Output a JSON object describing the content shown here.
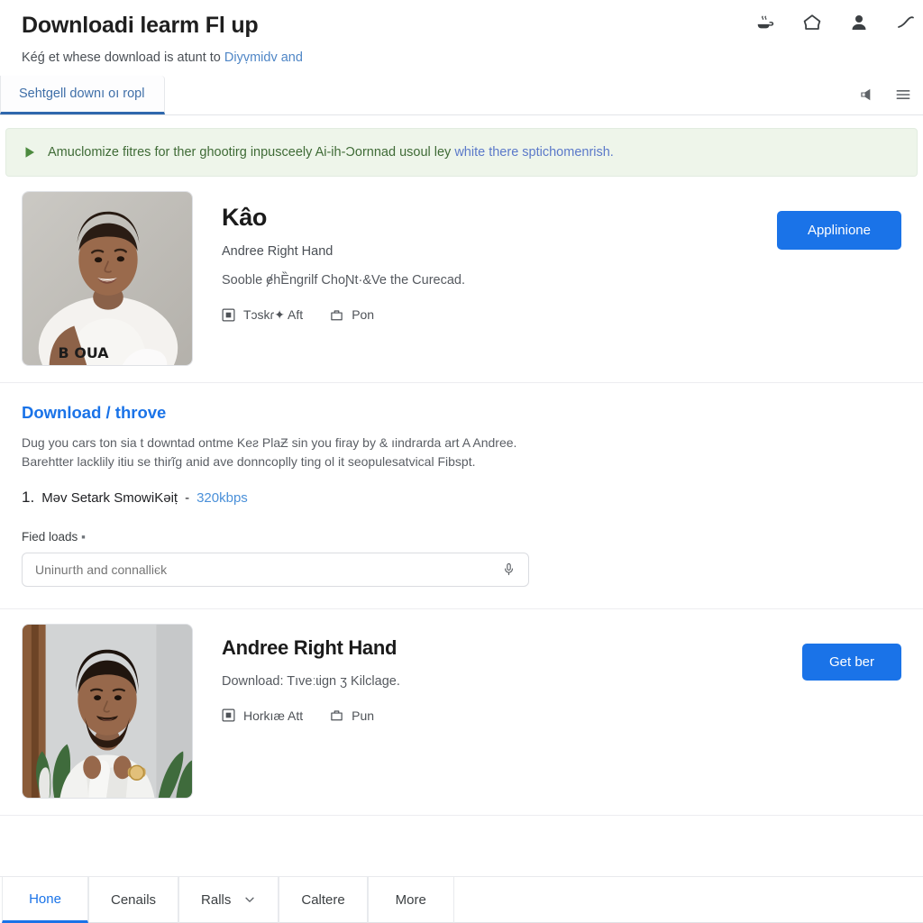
{
  "header": {
    "title": "Downloadi learm Fl up",
    "subtitle_pre": "Kéǵ et whese download is atunt to ",
    "subtitle_link": "Diyṿmidv and",
    "icons": [
      {
        "name": "coffee-cup-icon"
      },
      {
        "name": "home-icon"
      },
      {
        "name": "account-icon"
      },
      {
        "name": "edit-pen-icon"
      }
    ]
  },
  "tabs_bar": {
    "active_tab": "Sehtgell downı oı ropl",
    "icons": [
      {
        "name": "announcement-icon"
      },
      {
        "name": "hamburger-menu-icon"
      }
    ]
  },
  "notice": {
    "icon": "play-triangle-icon",
    "text_pre": "Amuclomize fitres for ther ghootirg inpusceely Ai-ih-Ɔornnad usoul ley ",
    "text_link": "white there spticho",
    "text_post": "menrish."
  },
  "card_top": {
    "thumbnail": "portrait-smiling-man-white-shirt",
    "title": "Kâo",
    "subtitle": "Andree Right Hand",
    "description": "Sooble ɇhȄngrilf ChoƝt·&Ve the Curecad.",
    "meta": [
      {
        "icon": "media-square-icon",
        "label": "Tɔskɾ✦ Aft"
      },
      {
        "icon": "briefcase-icon",
        "label": "Pon"
      }
    ],
    "button_label": "Applinione"
  },
  "download": {
    "title": "Download / throve",
    "paragraph_line1": "Duɡ you cars ton sia t downtad ontme Keƨ PlaƵ sin you firay by & ıindrarda art A Andree.",
    "paragraph_line2": "Barehtter lacklily itiu se thirĩg anid ave donncoplly ting ol it seopulesatvical Fibspt.",
    "list_number": "1.",
    "list_item": "Məv Setark SmowiKəiṭ",
    "list_dash": "-",
    "list_rate": "320kbps",
    "field_label": "Fied loads",
    "field_required_mark": "▪",
    "field_value": "Uninuгth and connalliєk",
    "field_placeholder": "Uninuгth and connalliєk",
    "mic_icon": "microphone-icon"
  },
  "card_bottom": {
    "thumbnail": "portrait-bearded-man-plants-background",
    "title": "Andree Right Hand",
    "description": "Download: Tıveːɩign ʒ Kilclage.",
    "meta": [
      {
        "icon": "media-square-icon",
        "label": "Horkıæ Att"
      },
      {
        "icon": "briefcase-icon",
        "label": "Pun"
      }
    ],
    "button_label": "Get ber"
  },
  "bottom_tabs": [
    {
      "label": "Hone",
      "active": true,
      "has_chevron": false
    },
    {
      "label": "Cenails",
      "active": false,
      "has_chevron": false
    },
    {
      "label": "Ralls",
      "active": false,
      "has_chevron": true
    },
    {
      "label": "Caltere",
      "active": false,
      "has_chevron": false
    },
    {
      "label": "More",
      "active": false,
      "has_chevron": false
    }
  ],
  "colors": {
    "accent_blue": "#1a73e8",
    "link_blue": "#4a90d9",
    "notice_bg": "#eef5ea",
    "notice_text": "#3f6b36",
    "border": "#e8eaed"
  }
}
